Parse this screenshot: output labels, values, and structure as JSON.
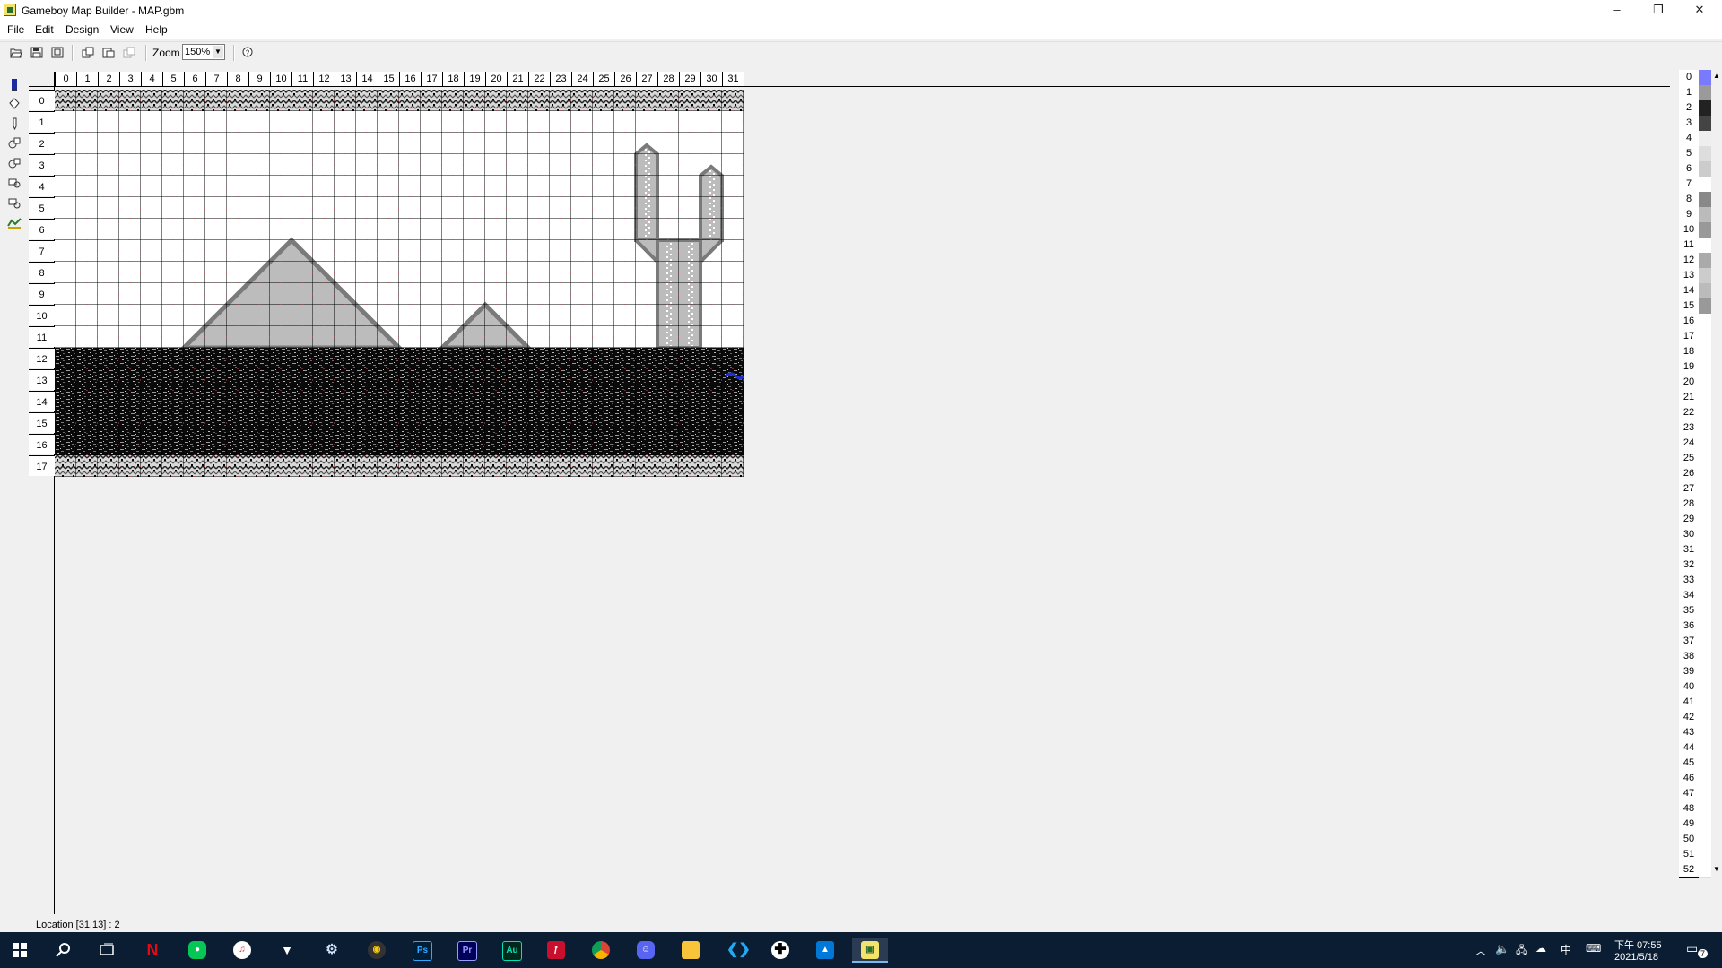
{
  "window": {
    "title": "Gameboy Map Builder - MAP.gbm",
    "minimize": "–",
    "restore": "❐",
    "close": "✕"
  },
  "menu": [
    "File",
    "Edit",
    "Design",
    "View",
    "Help"
  ],
  "toolbar": {
    "zoom_label": "Zoom",
    "zoom_value": "150%"
  },
  "grid": {
    "columns": [
      "0",
      "1",
      "2",
      "3",
      "4",
      "5",
      "6",
      "7",
      "8",
      "9",
      "10",
      "11",
      "12",
      "13",
      "14",
      "15",
      "16",
      "17",
      "18",
      "19",
      "20",
      "21",
      "22",
      "23",
      "24",
      "25",
      "26",
      "27",
      "28",
      "29",
      "30",
      "31"
    ],
    "rows": [
      "0",
      "1",
      "2",
      "3",
      "4",
      "5",
      "6",
      "7",
      "8",
      "9",
      "10",
      "11",
      "12",
      "13",
      "14",
      "15",
      "16",
      "17"
    ]
  },
  "tile_indices": [
    "0",
    "1",
    "2",
    "3",
    "4",
    "5",
    "6",
    "7",
    "8",
    "9",
    "10",
    "11",
    "12",
    "13",
    "14",
    "15",
    "16",
    "17",
    "18",
    "19",
    "20",
    "21",
    "22",
    "23",
    "24",
    "25",
    "26",
    "27",
    "28",
    "29",
    "30",
    "31",
    "32",
    "33",
    "34",
    "35",
    "36",
    "37",
    "38",
    "39",
    "40",
    "41",
    "42",
    "43",
    "44",
    "45",
    "46",
    "47",
    "48",
    "49",
    "50",
    "51",
    "52"
  ],
  "status": {
    "location": "Location  [31,13] : 2"
  },
  "tray": {
    "time": "下午 07:55",
    "date": "2021/5/18",
    "ime": "中",
    "notifications": "7"
  },
  "taskbar_apps": [
    "Ps",
    "Pr",
    "Au"
  ],
  "colors": {
    "accent": "#0078d7",
    "taskbar": "#0b1d33",
    "tile_light": "#bcbcbc",
    "tile_dark": "#7a7a7a"
  }
}
